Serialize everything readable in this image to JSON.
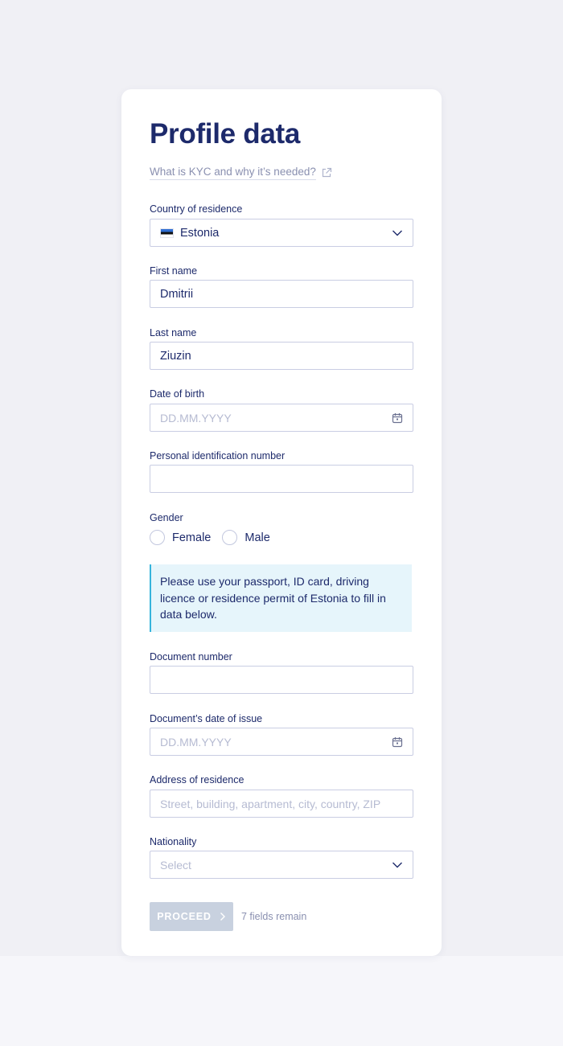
{
  "page": {
    "title": "Profile data",
    "kyc_link": "What is KYC and why it’s needed?"
  },
  "form": {
    "country": {
      "label": "Country of residence",
      "value": "Estonia"
    },
    "first_name": {
      "label": "First name",
      "value": "Dmitrii"
    },
    "last_name": {
      "label": "Last name",
      "value": "Ziuzin"
    },
    "date_of_birth": {
      "label": "Date of birth",
      "placeholder": "DD.MM.YYYY"
    },
    "personal_id": {
      "label": "Personal identification number",
      "value": ""
    },
    "gender": {
      "label": "Gender",
      "options": [
        "Female",
        "Male"
      ]
    },
    "notice": "Please use your passport, ID card, driving licence or residence permit of Estonia to fill in data below.",
    "document_number": {
      "label": "Document number",
      "value": ""
    },
    "document_issue_date": {
      "label": "Document’s date of issue",
      "placeholder": "DD.MM.YYYY"
    },
    "address": {
      "label": "Address of residence",
      "placeholder": "Street, building, apartment, city, country, ZIP"
    },
    "nationality": {
      "label": "Nationality",
      "placeholder": "Select"
    }
  },
  "footer": {
    "proceed_label": "PROCEED",
    "remaining": "7 fields remain"
  },
  "icons": {
    "kyc_link": "external-link-icon",
    "dropdown": "chevron-down-icon",
    "date": "calendar-icon",
    "proceed": "chevron-right-icon",
    "flag": "estonia-flag-icon"
  },
  "colors": {
    "heading": "#1d2a6b",
    "muted": "#8a90b0",
    "border": "#c9cde3",
    "notice_bg": "#e6f5fb",
    "notice_accent": "#36b4dc",
    "button_disabled": "#c8d1df",
    "page_bg": "#f0f0f5"
  }
}
